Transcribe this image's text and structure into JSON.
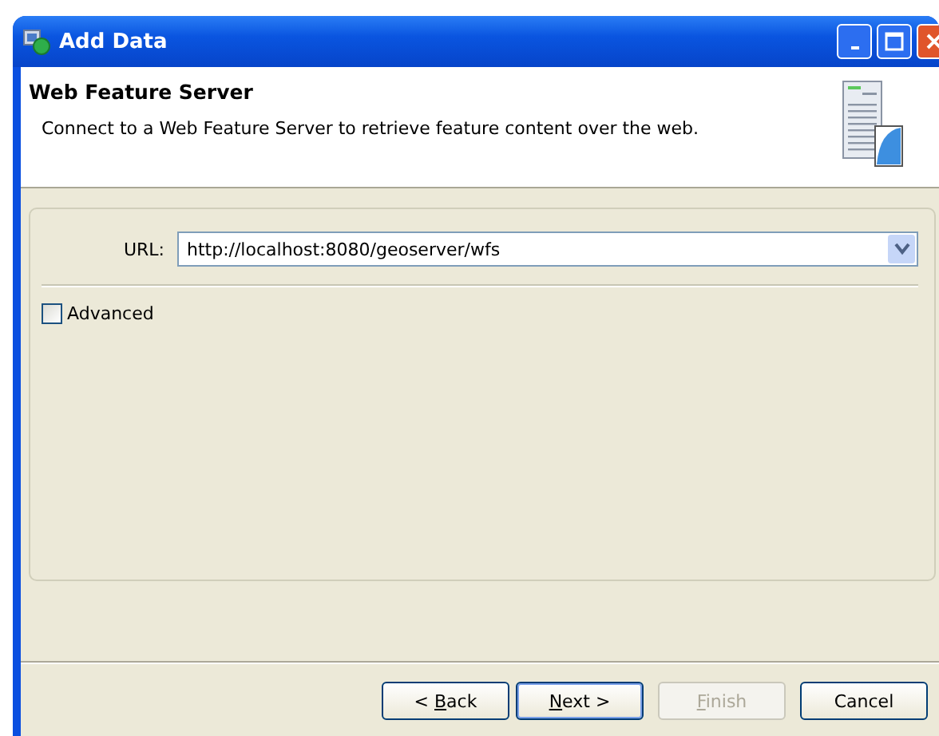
{
  "window": {
    "title": "Add Data"
  },
  "header": {
    "title": "Web Feature Server",
    "description": "Connect to a Web Feature Server to retrieve feature content over the web."
  },
  "url_field": {
    "label": "URL:",
    "value": "http://localhost:8080/geoserver/wfs"
  },
  "advanced": {
    "label": "Advanced",
    "checked": false
  },
  "buttons": [
    {
      "before": "< ",
      "key": "B",
      "after": "ack",
      "disabled": false,
      "default": false
    },
    {
      "key": "N",
      "after": "ext >",
      "disabled": false,
      "default": true
    },
    {
      "key": "F",
      "after": "inish",
      "disabled": true,
      "default": false
    },
    {
      "before": "Cancel",
      "disabled": false,
      "default": false
    }
  ]
}
